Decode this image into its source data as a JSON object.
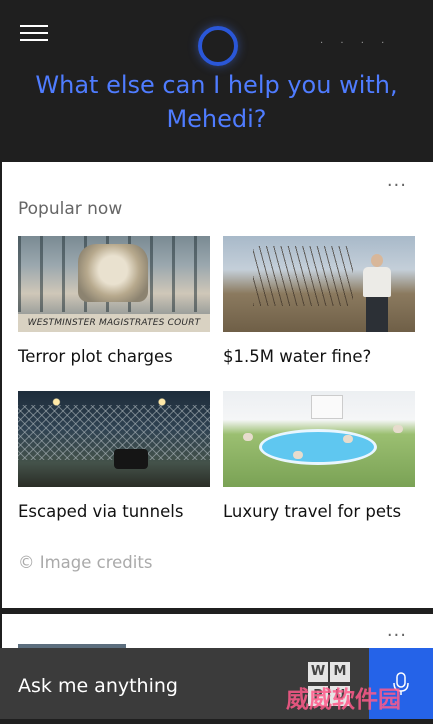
{
  "header": {
    "menu_icon": "hamburger-icon",
    "logo_icon": "cortana-ring-icon",
    "greeting_line1": "What else can I help you with,",
    "greeting_line2": "Mehedi?",
    "accent_color": "#4f7cff"
  },
  "card": {
    "more_label": "...",
    "section_title": "Popular now",
    "tiles": [
      {
        "caption": "Terror plot charges",
        "image_text": "WESTMINSTER MAGISTRATES COURT"
      },
      {
        "caption": "$1.5M water fine?"
      },
      {
        "caption": "Escaped via tunnels"
      },
      {
        "caption": "Luxury travel for pets"
      }
    ],
    "credits": "© Image credits"
  },
  "card2": {
    "more_label": "..."
  },
  "bottom_bar": {
    "placeholder": "Ask me anything",
    "mic_icon": "microphone-icon",
    "mic_color": "#2563e8"
  },
  "watermark": {
    "letters": [
      "W",
      "M",
      "P",
      "U"
    ],
    "text": "威威软件园"
  }
}
